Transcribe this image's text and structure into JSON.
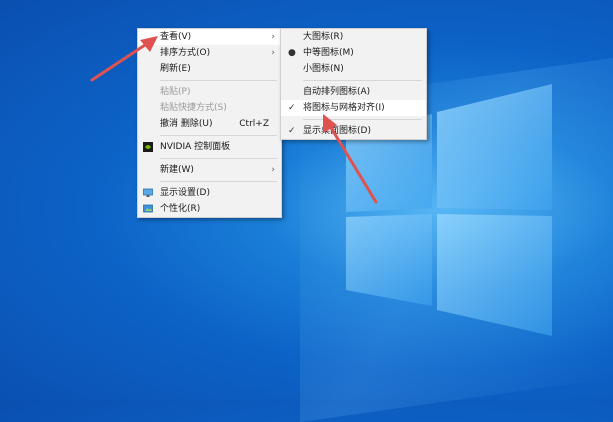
{
  "context_menu": {
    "items": [
      {
        "label": "查看(V)",
        "submenu": true,
        "disabled": false,
        "hover": true
      },
      {
        "label": "排序方式(O)",
        "submenu": true,
        "disabled": false
      },
      {
        "label": "刷新(E)",
        "submenu": false,
        "disabled": false
      },
      {
        "separator": true
      },
      {
        "label": "粘贴(P)",
        "submenu": false,
        "disabled": true
      },
      {
        "label": "粘贴快捷方式(S)",
        "submenu": false,
        "disabled": true
      },
      {
        "label": "撤消 删除(U)",
        "shortcut": "Ctrl+Z",
        "submenu": false,
        "disabled": false
      },
      {
        "separator": true
      },
      {
        "label": "NVIDIA 控制面板",
        "icon": "nvidia-icon",
        "submenu": false,
        "disabled": false
      },
      {
        "separator": true
      },
      {
        "label": "新建(W)",
        "submenu": true,
        "disabled": false
      },
      {
        "separator": true
      },
      {
        "label": "显示设置(D)",
        "icon": "display-settings-icon",
        "submenu": false,
        "disabled": false
      },
      {
        "label": "个性化(R)",
        "icon": "personalize-icon",
        "submenu": false,
        "disabled": false
      }
    ]
  },
  "view_submenu": {
    "items": [
      {
        "label": "大图标(R)",
        "mark": ""
      },
      {
        "label": "中等图标(M)",
        "mark": "●"
      },
      {
        "label": "小图标(N)",
        "mark": ""
      },
      {
        "separator": true
      },
      {
        "label": "自动排列图标(A)",
        "mark": ""
      },
      {
        "label": "将图标与网格对齐(I)",
        "mark": "✓",
        "hover": true
      },
      {
        "separator": true
      },
      {
        "label": "显示桌面图标(D)",
        "mark": "✓"
      }
    ]
  },
  "annotation_color": "#e0524f"
}
